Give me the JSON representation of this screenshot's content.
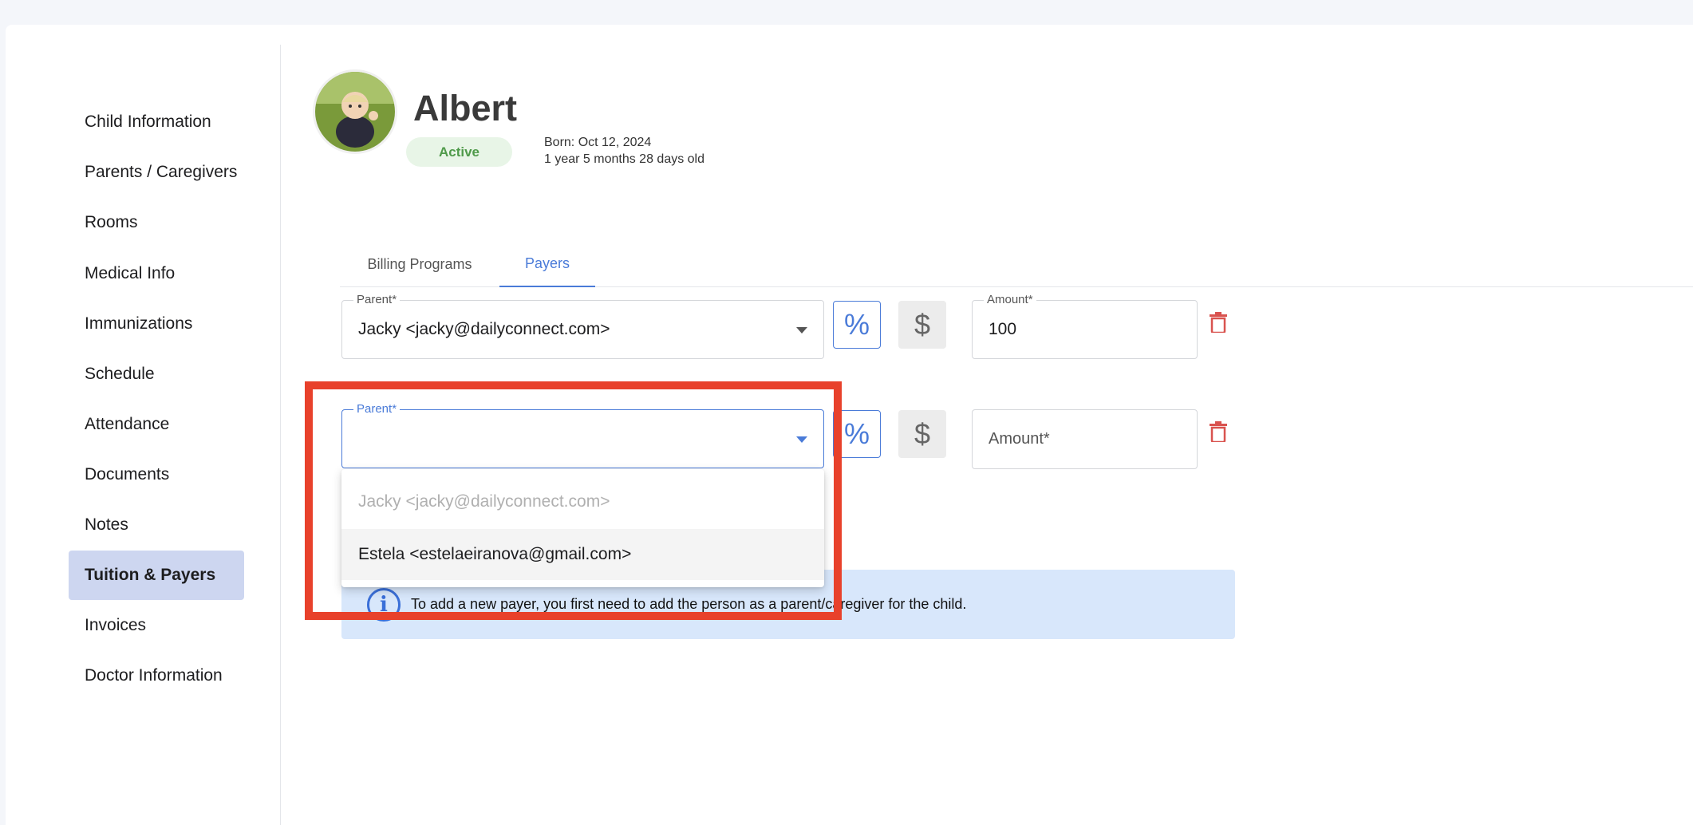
{
  "sidebar": {
    "items": [
      {
        "label": "Child Information"
      },
      {
        "label": "Parents / Caregivers"
      },
      {
        "label": "Rooms"
      },
      {
        "label": "Medical Info"
      },
      {
        "label": "Immunizations"
      },
      {
        "label": "Schedule"
      },
      {
        "label": "Attendance"
      },
      {
        "label": "Documents"
      },
      {
        "label": "Notes"
      },
      {
        "label": "Tuition & Payers",
        "active": true
      },
      {
        "label": "Invoices"
      },
      {
        "label": "Doctor Information"
      }
    ]
  },
  "profile": {
    "name": "Albert",
    "status": "Active",
    "born": "Born: Oct 12, 2024",
    "age": "1 year 5 months 28 days old"
  },
  "tabs": [
    {
      "label": "Billing Programs",
      "active": false
    },
    {
      "label": "Payers",
      "active": true
    }
  ],
  "payers": [
    {
      "parent_label": "Parent*",
      "parent_value": "Jacky <jacky@dailyconnect.com>",
      "percent_symbol": "%",
      "dollar_symbol": "$",
      "amount_label": "Amount*",
      "amount_value": "100"
    },
    {
      "parent_label": "Parent*",
      "parent_value": "",
      "percent_symbol": "%",
      "dollar_symbol": "$",
      "amount_placeholder": "Amount*"
    }
  ],
  "dropdown": {
    "options": [
      {
        "label": "Jacky <jacky@dailyconnect.com>",
        "disabled": true
      },
      {
        "label": "Estela <estelaeiranova@gmail.com>",
        "hovered": true
      }
    ]
  },
  "info": {
    "icon": "info-icon",
    "text": "To add a new payer, you first need to add the person as a parent/caregiver for the child."
  },
  "colors": {
    "accent": "#4a7bd8",
    "active_sidebar": "#cdd6f0",
    "status_bg": "#e8f5e7",
    "status_text": "#4f9a4a",
    "info_bg": "#d8e7fb",
    "delete": "#d9534f",
    "highlight": "#e8412b"
  }
}
